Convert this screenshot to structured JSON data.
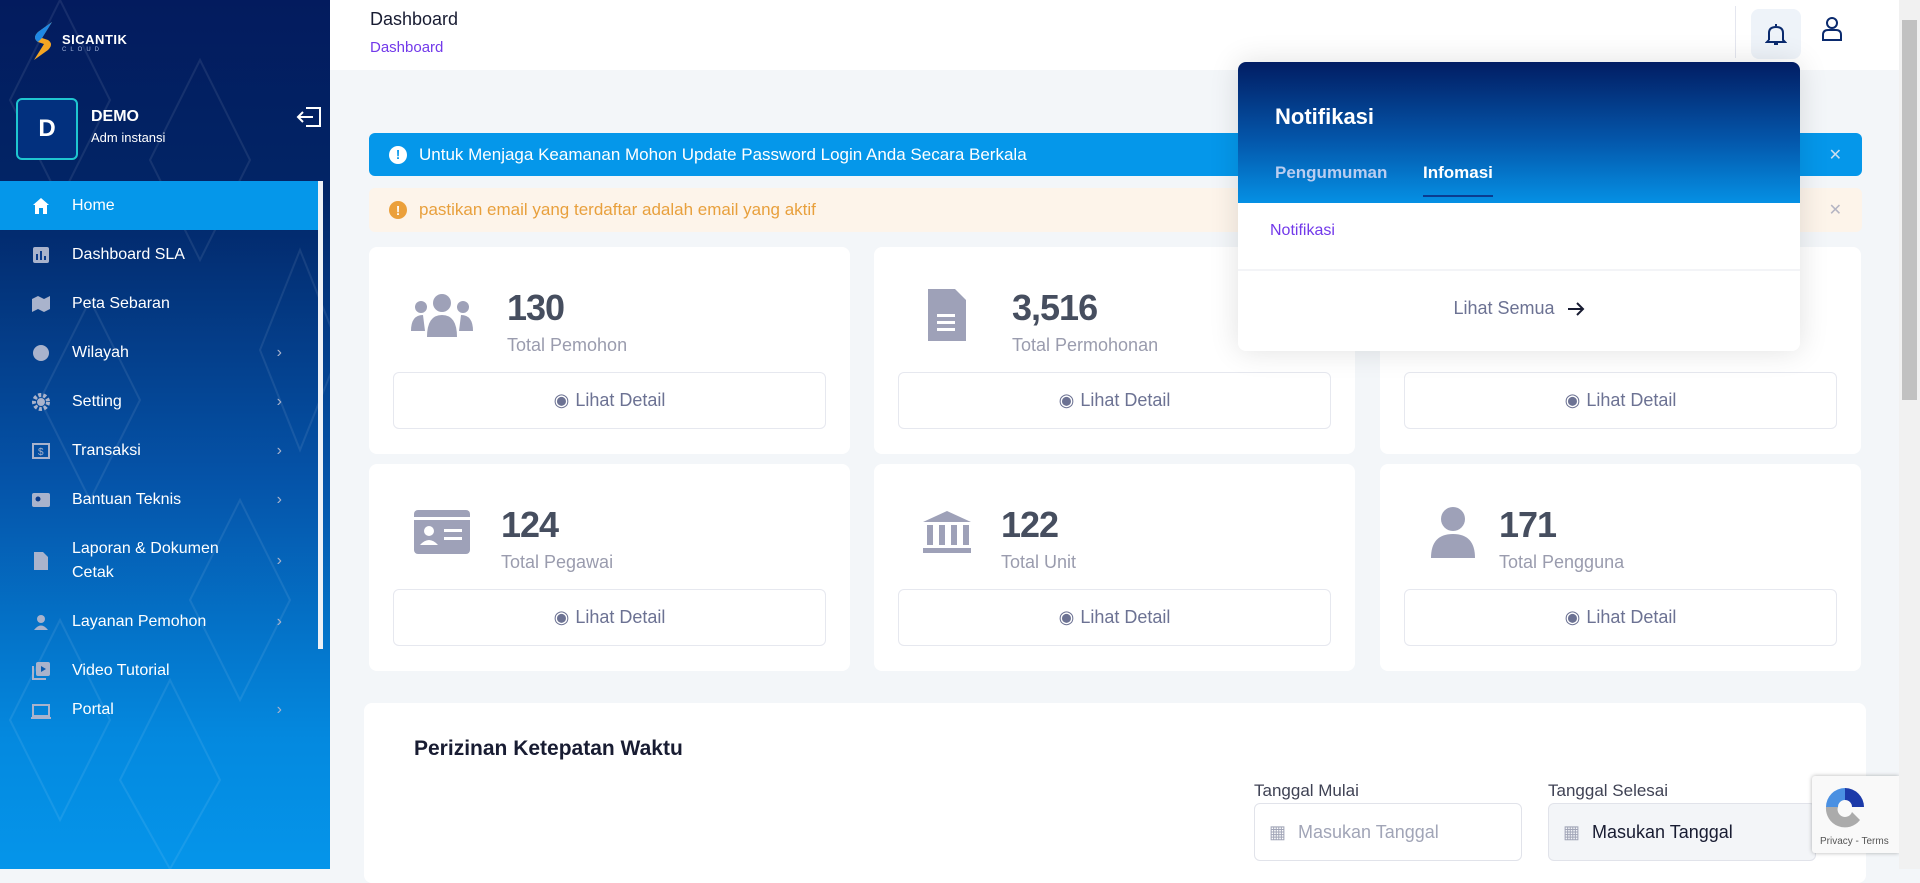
{
  "brand": {
    "name": "SICANTIK",
    "sub": "CLOUD"
  },
  "user": {
    "initial": "D",
    "name": "DEMO",
    "role": "Adm instansi"
  },
  "sidebar": {
    "items": [
      {
        "label": "Home",
        "icon": "home-icon",
        "active": true
      },
      {
        "label": "Dashboard SLA",
        "icon": "chart-icon"
      },
      {
        "label": "Peta Sebaran",
        "icon": "map-icon"
      },
      {
        "label": "Wilayah",
        "icon": "globe-icon",
        "submenu": true
      },
      {
        "label": "Setting",
        "icon": "gear-icon",
        "submenu": true
      },
      {
        "label": "Transaksi",
        "icon": "money-icon",
        "submenu": true
      },
      {
        "label": "Bantuan Teknis",
        "icon": "contact-card-icon",
        "submenu": true
      },
      {
        "label": "Laporan & Dokumen Cetak",
        "icon": "document-icon",
        "submenu": true
      },
      {
        "label": "Layanan Pemohon",
        "icon": "person-icon",
        "submenu": true
      },
      {
        "label": "Video Tutorial",
        "icon": "video-icon"
      },
      {
        "label": "Portal",
        "icon": "laptop-icon",
        "submenu": true
      }
    ]
  },
  "header": {
    "title": "Dashboard",
    "breadcrumb": "Dashboard"
  },
  "alerts": [
    {
      "text": "Untuk Menjaga Keamanan Mohon Update Password Login Anda Secara Berkala",
      "type": "info"
    },
    {
      "text": "pastikan email yang terdaftar adalah email yang aktif",
      "type": "warning"
    }
  ],
  "stats": [
    {
      "value": "130",
      "label": "Total Pemohon",
      "icon": "users-icon",
      "button": "Lihat Detail"
    },
    {
      "value": "3,516",
      "label": "Total Permohonan",
      "icon": "file-icon",
      "button": "Lihat Detail"
    },
    {
      "value": "",
      "label": "",
      "icon": "",
      "button": "Lihat Detail"
    },
    {
      "value": "124",
      "label": "Total Pegawai",
      "icon": "id-card-icon",
      "button": "Lihat Detail"
    },
    {
      "value": "122",
      "label": "Total Unit",
      "icon": "bank-icon",
      "button": "Lihat Detail"
    },
    {
      "value": "171",
      "label": "Total Pengguna",
      "icon": "user-icon",
      "button": "Lihat Detail"
    }
  ],
  "panel": {
    "title": "Perizinan Ketepatan Waktu",
    "start_label": "Tanggal Mulai",
    "start_placeholder": "Masukan Tanggal",
    "end_label": "Tanggal Selesai",
    "end_value": "Masukan Tanggal"
  },
  "notifications": {
    "title": "Notifikasi",
    "tabs": [
      "Pengumuman",
      "Infomasi"
    ],
    "active_tab": "Infomasi",
    "item": "Notifikasi",
    "view_all": "Lihat Semua"
  },
  "recaptcha": {
    "text": "Privacy - Terms"
  },
  "colors": {
    "primary": "#0597ea",
    "sidebar_dark": "#031b5e",
    "warning": "#e8a03d",
    "accent": "#7239ea"
  }
}
